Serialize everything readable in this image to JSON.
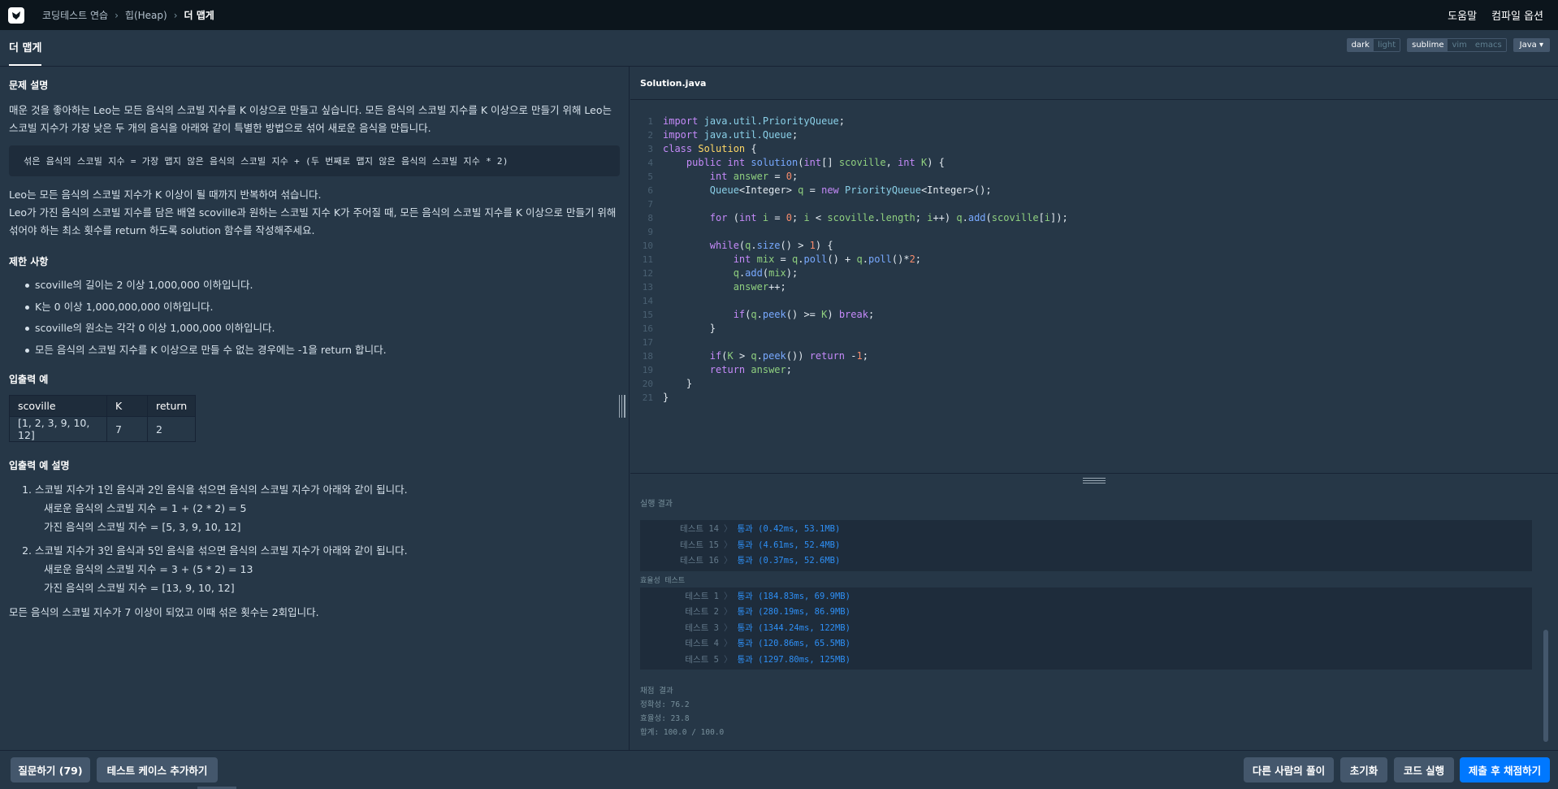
{
  "breadcrumb": {
    "items": [
      "코딩테스트 연습",
      "힙(Heap)"
    ],
    "current": "더 맵게"
  },
  "top_right": {
    "help": "도움말",
    "compile_options": "컴파일 옵션"
  },
  "problem_tab": "더 맵게",
  "toggles": {
    "theme": [
      "dark",
      "light"
    ],
    "theme_active": "dark",
    "keymap": [
      "sublime",
      "vim",
      "emacs"
    ],
    "keymap_active": "sublime",
    "language": "Java"
  },
  "problem": {
    "desc_heading": "문제 설명",
    "desc_p1": "매운 것을 좋아하는 Leo는 모든 음식의 스코빌 지수를 K 이상으로 만들고 싶습니다. 모든 음식의 스코빌 지수를 K 이상으로 만들기 위해 Leo는 스코빌 지수가 가장 낮은 두 개의 음식을 아래와 같이 특별한 방법으로 섞어 새로운 음식을 만듭니다.",
    "formula": "섞은 음식의 스코빌 지수 = 가장 맵지 않은 음식의 스코빌 지수 + (두 번째로 맵지 않은 음식의 스코빌 지수 * 2)",
    "desc_p2": "Leo는 모든 음식의 스코빌 지수가 K 이상이 될 때까지 반복하여 섞습니다.",
    "desc_p3": "Leo가 가진 음식의 스코빌 지수를 담은 배열 scoville과 원하는 스코빌 지수 K가 주어질 때, 모든 음식의 스코빌 지수를 K 이상으로 만들기 위해 섞어야 하는 최소 횟수를 return 하도록 solution 함수를 작성해주세요.",
    "limits_heading": "제한 사항",
    "limits": [
      "scoville의 길이는 2 이상 1,000,000 이하입니다.",
      "K는 0 이상 1,000,000,000 이하입니다.",
      "scoville의 원소는 각각 0 이상 1,000,000 이하입니다.",
      "모든 음식의 스코빌 지수를 K 이상으로 만들 수 없는 경우에는 -1을 return 합니다."
    ],
    "io_heading": "입출력 예",
    "io_headers": [
      "scoville",
      "K",
      "return"
    ],
    "io_row": [
      "[1, 2, 3, 9, 10, 12]",
      "7",
      "2"
    ],
    "io_expl_heading": "입출력 예 설명",
    "expl": [
      {
        "num": "1.",
        "main": "스코빌 지수가 1인 음식과 2인 음식을 섞으면 음식의 스코빌 지수가 아래와 같이 됩니다.",
        "sub1": "새로운 음식의 스코빌 지수 = 1 + (2 * 2) = 5",
        "sub2": "가진 음식의 스코빌 지수 = [5, 3, 9, 10, 12]"
      },
      {
        "num": "2.",
        "main": "스코빌 지수가 3인 음식과 5인 음식을 섞으면 음식의 스코빌 지수가 아래와 같이 됩니다.",
        "sub1": "새로운 음식의 스코빌 지수 = 3 + (5 * 2) = 13",
        "sub2": "가진 음식의 스코빌 지수 = [13, 9, 10, 12]"
      }
    ],
    "conclusion": "모든 음식의 스코빌 지수가 7 이상이 되었고 이때 섞은 횟수는 2회입니다."
  },
  "editor": {
    "filename": "Solution.java",
    "line_numbers": [
      "1",
      "2",
      "3",
      "4",
      "5",
      "6",
      "7",
      "8",
      "9",
      "10",
      "11",
      "12",
      "13",
      "14",
      "15",
      "16",
      "17",
      "18",
      "19",
      "20",
      "21"
    ]
  },
  "results": {
    "title": "실행 결과",
    "accuracy_tests": [
      {
        "label": "테스트 14",
        "result": "통과 (0.42ms, 53.1MB)"
      },
      {
        "label": "테스트 15",
        "result": "통과 (4.61ms, 52.4MB)"
      },
      {
        "label": "테스트 16",
        "result": "통과 (0.37ms, 52.6MB)"
      }
    ],
    "efficiency_label": "효율성  테스트",
    "efficiency_tests": [
      {
        "label": "테스트 1",
        "result": "통과 (184.83ms, 69.9MB)"
      },
      {
        "label": "테스트 2",
        "result": "통과 (280.19ms, 86.9MB)"
      },
      {
        "label": "테스트 3",
        "result": "통과 (1344.24ms, 122MB)"
      },
      {
        "label": "테스트 4",
        "result": "통과 (120.86ms, 65.5MB)"
      },
      {
        "label": "테스트 5",
        "result": "통과 (1297.80ms, 125MB)"
      }
    ],
    "final_title": "채점 결과",
    "accuracy": "정확성: 76.2",
    "efficiency": "효율성: 23.8",
    "total": "합계: 100.0 / 100.0"
  },
  "buttons": {
    "ask": "질문하기 (79)",
    "add_testcase": "테스트 케이스 추가하기",
    "others_solutions": "다른 사람의 풀이",
    "reset": "초기화",
    "run": "코드 실행",
    "submit": "제출 후 채점하기"
  }
}
